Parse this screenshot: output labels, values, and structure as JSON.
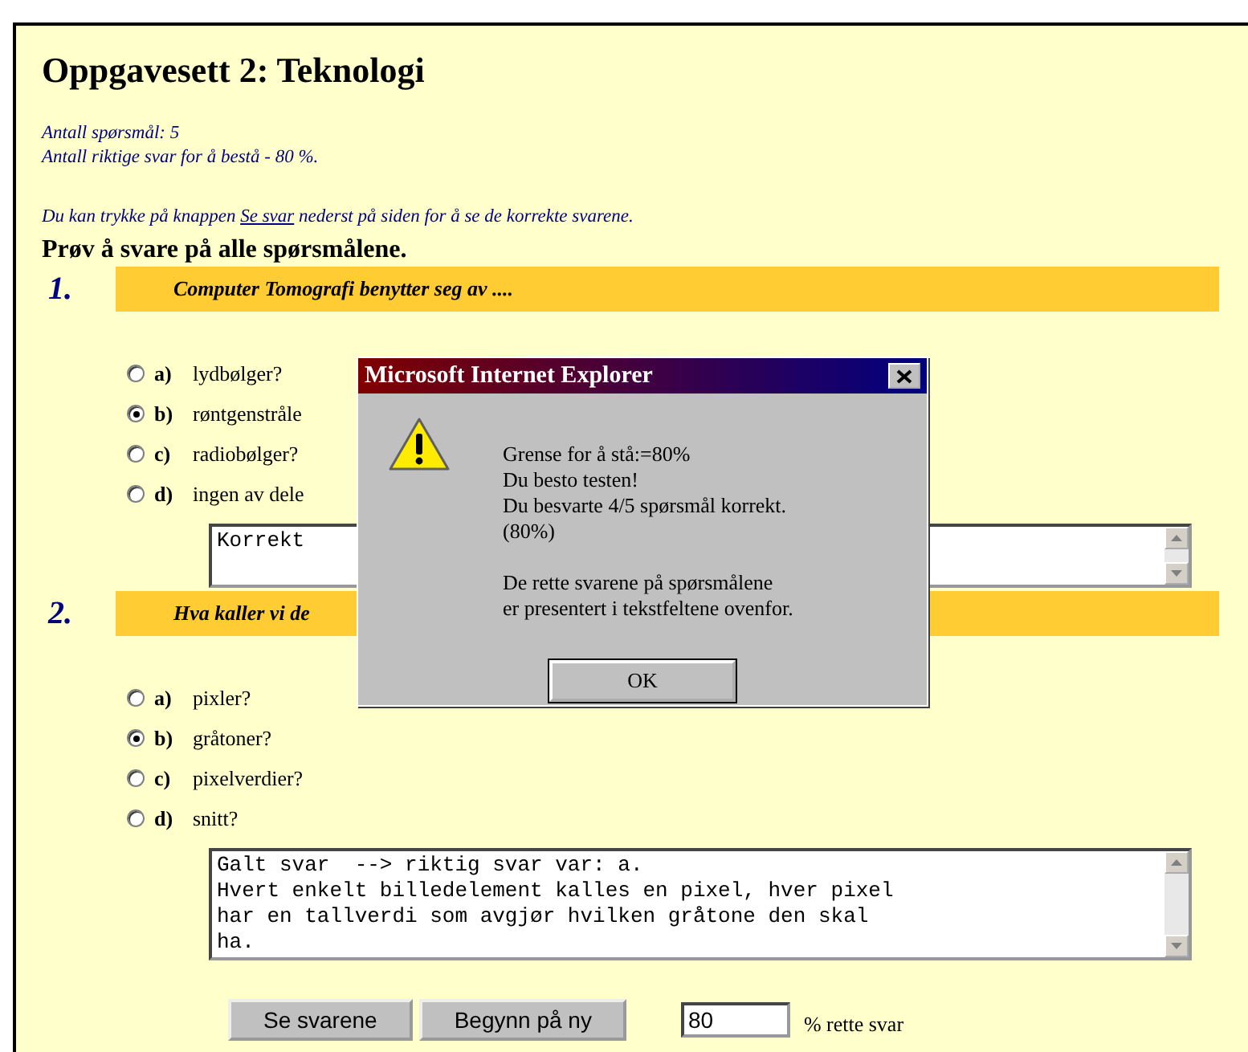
{
  "page": {
    "title": "Oppgavesett 2: Teknologi",
    "info": [
      "Antall spørsmål: 5",
      "Antall riktige svar for å bestå - 80 %."
    ],
    "hint": {
      "before": "Du kan trykke på knappen ",
      "link": "Se svar",
      "after": " nederst på siden for å se de korrekte svarene."
    },
    "instruction": "Prøv å svare på alle spørsmålene."
  },
  "questions": [
    {
      "number": "1.",
      "question": "Computer Tomografi benytter seg av ....",
      "options": [
        {
          "letter": "a)",
          "text": "lydbølger?",
          "selected": false
        },
        {
          "letter": "b)",
          "text": "røntgenstråle",
          "selected": true
        },
        {
          "letter": "c)",
          "text": "radiobølger?",
          "selected": false
        },
        {
          "letter": "d)",
          "text": "ingen av dele",
          "selected": false
        }
      ],
      "feedback": "Korrekt"
    },
    {
      "number": "2.",
      "question": "Hva kaller vi de",
      "options": [
        {
          "letter": "a)",
          "text": "pixler?",
          "selected": false
        },
        {
          "letter": "b)",
          "text": "gråtoner?",
          "selected": true
        },
        {
          "letter": "c)",
          "text": "pixelverdier?",
          "selected": false
        },
        {
          "letter": "d)",
          "text": "snitt?",
          "selected": false
        }
      ],
      "feedback": "Galt svar  --> riktig svar var: a.\nHvert enkelt billedelement kalles en pixel, hver pixel\nhar en tallverdi som avgjør hvilken gråtone den skal\nha."
    }
  ],
  "footer": {
    "buttons": [
      "Se svarene",
      "Begynn på ny"
    ],
    "score": {
      "value": "80",
      "label": "% rette svar"
    }
  },
  "dialog": {
    "title": "Microsoft Internet Explorer",
    "paragraphs": [
      [
        "Grense for å stå:=80%",
        "Du besto testen!",
        "Du besvarte 4/5 spørsmål korrekt.",
        "(80%)"
      ],
      [
        "De rette svarene på spørsmålene",
        "er presentert i tekstfeltene ovenfor."
      ]
    ],
    "button": "OK"
  }
}
